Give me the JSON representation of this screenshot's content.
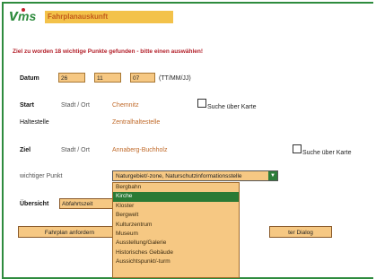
{
  "app": {
    "logo_text": "vms",
    "banner_text": "Fahrplanauskunft",
    "brand_color": "#2e8b3e",
    "accent_color": "#f3c24a"
  },
  "message": "Ziel zu worden 18 wichtige Punkte gefunden - bitte einen auswählen!",
  "datum": {
    "label": "Datum",
    "day": "26",
    "month": "11",
    "year": "07",
    "format_hint": "(TT/MM/JJ)"
  },
  "start": {
    "label": "Start",
    "type": "Stadt / Ort",
    "value": "Chemnitz",
    "map_search": "Suche über Karte",
    "stop_label": "Haltestelle",
    "stop_value": "Zentralhaltestelle"
  },
  "ziel": {
    "label": "Ziel",
    "type": "Stadt / Ort",
    "value": "Annaberg-Buchholz",
    "map_search": "Suche über Karte",
    "poi_label": "wichtiger Punkt",
    "poi_selected": "Naturgebiet/-zone, Naturschutzinformationsstelle"
  },
  "dropdown": {
    "options": [
      "Bergbahn",
      "Kirche",
      "Kloster",
      "Bergwelt",
      "Kulturzentrum",
      "Museum",
      "Ausstellung/Galerie",
      "Historisches Gebäude",
      "Aussichtspunkt/-turm"
    ],
    "highlighted_index": 1
  },
  "uebersicht": {
    "label": "Übersicht",
    "value": "Abfahrtszeit"
  },
  "buttons": {
    "fahrplan": "Fahrplan anfordern",
    "dialog": "ter Dialog"
  }
}
